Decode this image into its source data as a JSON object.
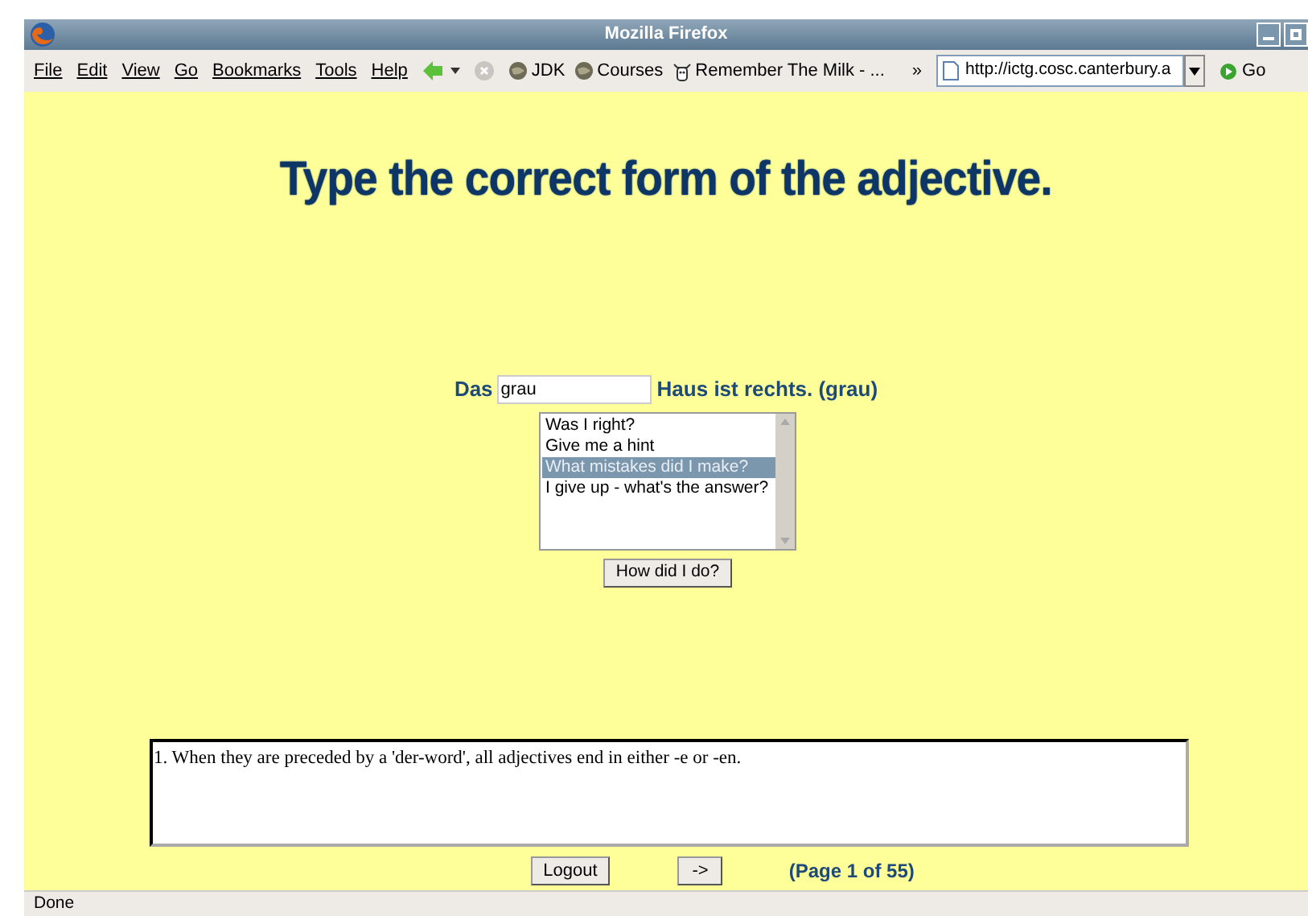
{
  "window": {
    "title": "Mozilla Firefox"
  },
  "menu": [
    "File",
    "Edit",
    "View",
    "Go",
    "Bookmarks",
    "Tools",
    "Help"
  ],
  "bookmarks": [
    {
      "label": "JDK",
      "kind": "globe"
    },
    {
      "label": "Courses",
      "kind": "globe"
    },
    {
      "label": "Remember The Milk - ...",
      "kind": "cow"
    }
  ],
  "overflow": "»",
  "url": "http://ictg.cosc.canterbury.a",
  "go": "Go",
  "heading": "Type the correct form of the adjective.",
  "sentence": {
    "before": "Das",
    "value": "grau",
    "after": "Haus ist rechts. (grau)"
  },
  "options": [
    {
      "label": "Was I right?",
      "selected": false
    },
    {
      "label": "Give me a hint",
      "selected": false
    },
    {
      "label": "What mistakes did I make?",
      "selected": true
    },
    {
      "label": "I give up - what's the answer?",
      "selected": false
    }
  ],
  "check_button": "How did I do?",
  "feedback": "1. When they are preceded by a 'der-word', all adjectives end in either -e or -en.",
  "logout": "Logout",
  "next": "->",
  "page": "(Page 1 of 55)",
  "status": "Done"
}
